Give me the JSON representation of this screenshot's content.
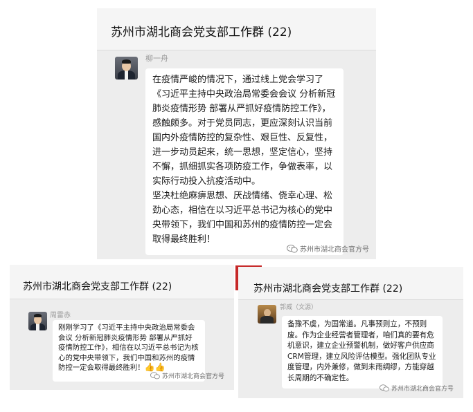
{
  "panel1": {
    "title": "苏州市湖北商会党支部工作群 (22)",
    "sender": "柳一舟",
    "message": "在疫情严峻的情况下，通过线上党会学习了《习近平主持中央政治局常委会会议 分析新冠肺炎疫情形势 部署从严抓好疫情防控工作》，感触颇多。对于党员同志，更应深刻认识当前国内外疫情防控的复杂性、艰巨性、反复性，进一步动员起来，统一思想，坚定信心，坚持不懈，抓细抓实各项防疫工作，争做表率，以实际行动投入抗疫活动中。\n坚决杜绝麻痹思想、厌战情绪、侥幸心理、松劲心态，相信在以习近平总书记为核心的党中央带领下，我们中国和苏州的疫情防控一定会取得最终胜利！",
    "watermark": "苏州市湖北商会官方号"
  },
  "panel2": {
    "title": "苏州市湖北商会党支部工作群 (22)",
    "sender": "周雷赤",
    "message": "刚刚学习了《习近平主持中央政治局常委会会议 分析新冠肺炎疫情形势 部署从严抓好疫情防控工作》，相信在以习近平总书记为核心的党中央带领下，我们中国和苏州的疫情防控一定会取得最终胜利！",
    "emoji": "👍👍",
    "watermark": "苏州市湖北商会官方号"
  },
  "panel3": {
    "title": "苏州市湖北商会党支部工作群 (22)",
    "sender": "郭威（文源）",
    "message": "备豫不虞，为国常道。凡事预则立，不预则废。作为企业经营者管理者，咱们真的要有危机意识，建立企业预警机制，做好客户供应商CRM管理，建立风险评估模型。强化团队专业度管理，内外兼修，做到未雨绸缪，方能穿越长周期的不确定性。",
    "watermark": "苏州市湖北商会官方号"
  },
  "colors": {
    "panel_bg": "#ededed",
    "header_bg": "#f5f5f5",
    "bubble_bg": "#ffffff",
    "accent_red": "#c62828"
  },
  "icons": [
    "avatar-photo",
    "wechat-official-account-icon",
    "thumbs-up-emoji"
  ]
}
